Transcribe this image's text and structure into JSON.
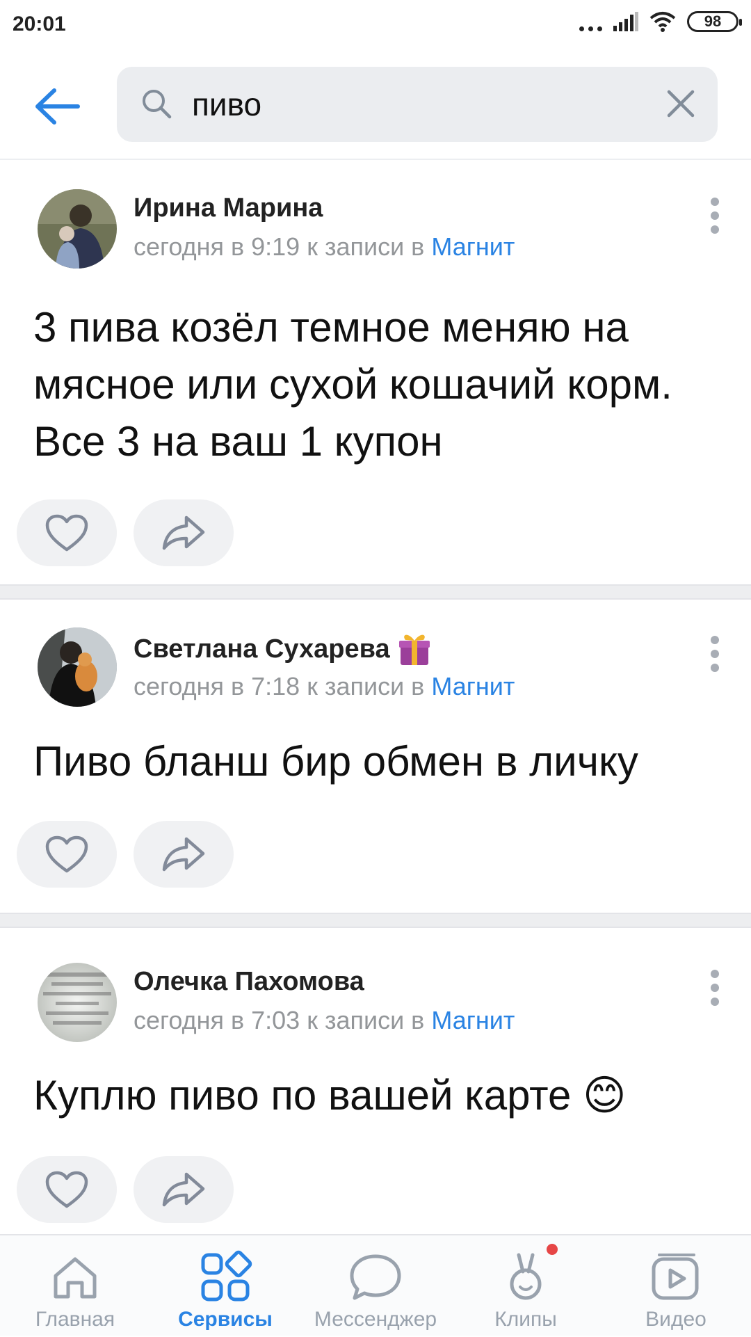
{
  "status_bar": {
    "time": "20:01",
    "battery": "98"
  },
  "search": {
    "query": "пиво"
  },
  "posts": [
    {
      "author": "Ирина Марина",
      "time": "сегодня в 9:19",
      "context": "к записи в",
      "group": "Магнит",
      "text": "3 пива козёл темное меняю на мясное или сухой кошачий корм. Все 3 на ваш 1 купон"
    },
    {
      "author": "Светлана Сухарева",
      "time": "сегодня в 7:18",
      "context": "к записи в",
      "group": "Магнит",
      "text": "Пиво бланш бир обмен в личку"
    },
    {
      "author": "Олечка Пахомова",
      "time": "сегодня в 7:03",
      "context": "к записи в",
      "group": "Магнит",
      "text": "Куплю пиво по вашей карте 😊",
      "avatar_text": "Папа... как жаль, что ты не приедешь завтра. и послезавтра. и никогда."
    }
  ],
  "tabbar": {
    "items": [
      {
        "label": "Главная",
        "icon": "home-icon",
        "active": false
      },
      {
        "label": "Сервисы",
        "icon": "services-icon",
        "active": true
      },
      {
        "label": "Мессенджер",
        "icon": "chat-icon",
        "active": false
      },
      {
        "label": "Клипы",
        "icon": "clips-icon",
        "active": false
      },
      {
        "label": "Видео",
        "icon": "video-icon",
        "active": false
      }
    ]
  },
  "colors": {
    "accent": "#2a83e3",
    "meta_gray": "#939699",
    "field_bg": "#ebedf0",
    "notify": "#e64646"
  }
}
